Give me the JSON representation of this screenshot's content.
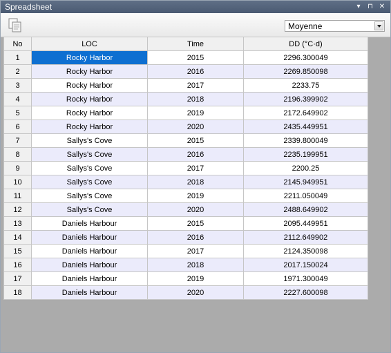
{
  "window": {
    "title": "Spreadsheet"
  },
  "titlebar_buttons": {
    "menu": "▾",
    "pin": "⊓",
    "close": "✕"
  },
  "toolbar": {
    "copy_icon": "copy-icon",
    "select_value": "Moyenne"
  },
  "table": {
    "headers": [
      "No",
      "LOC",
      "Time",
      "DD (°C·d)"
    ],
    "rows": [
      [
        "1",
        "Rocky Harbor",
        "2015",
        "2296.300049"
      ],
      [
        "2",
        "Rocky Harbor",
        "2016",
        "2269.850098"
      ],
      [
        "3",
        "Rocky Harbor",
        "2017",
        "2233.75"
      ],
      [
        "4",
        "Rocky Harbor",
        "2018",
        "2196.399902"
      ],
      [
        "5",
        "Rocky Harbor",
        "2019",
        "2172.649902"
      ],
      [
        "6",
        "Rocky Harbor",
        "2020",
        "2435.449951"
      ],
      [
        "7",
        "Sallys's Cove",
        "2015",
        "2339.800049"
      ],
      [
        "8",
        "Sallys's Cove",
        "2016",
        "2235.199951"
      ],
      [
        "9",
        "Sallys's Cove",
        "2017",
        "2200.25"
      ],
      [
        "10",
        "Sallys's Cove",
        "2018",
        "2145.949951"
      ],
      [
        "11",
        "Sallys's Cove",
        "2019",
        "2211.050049"
      ],
      [
        "12",
        "Sallys's Cove",
        "2020",
        "2488.649902"
      ],
      [
        "13",
        "Daniels Harbour",
        "2015",
        "2095.449951"
      ],
      [
        "14",
        "Daniels Harbour",
        "2016",
        "2112.649902"
      ],
      [
        "15",
        "Daniels Harbour",
        "2017",
        "2124.350098"
      ],
      [
        "16",
        "Daniels Harbour",
        "2018",
        "2017.150024"
      ],
      [
        "17",
        "Daniels Harbour",
        "2019",
        "1971.300049"
      ],
      [
        "18",
        "Daniels Harbour",
        "2020",
        "2227.600098"
      ]
    ]
  },
  "selection": {
    "row": 1,
    "column": "LOC"
  },
  "colors": {
    "selection": "#0e6fd1",
    "alt_row": "#ebebfb",
    "workspace": "#ababab",
    "titlebar": "#56657c"
  }
}
